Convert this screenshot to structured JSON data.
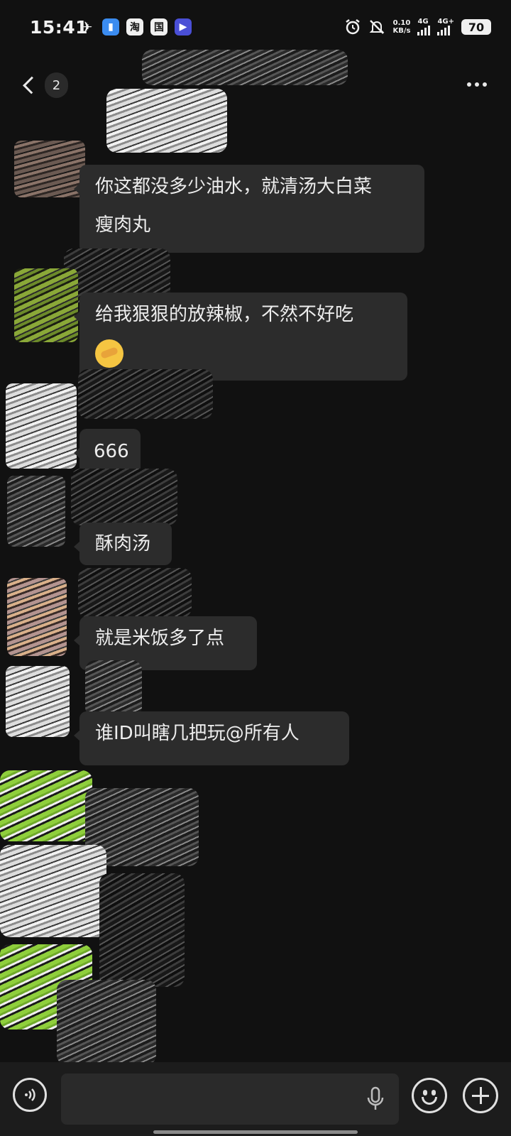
{
  "status_bar": {
    "time": "15:41",
    "app_icons": [
      {
        "name": "pinduoduo-icon",
        "glyph": "✈",
        "style": "plain"
      },
      {
        "name": "notes-app-icon",
        "glyph": "▮",
        "style": "blue"
      },
      {
        "name": "taobao-icon",
        "glyph": "淘",
        "style": ""
      },
      {
        "name": "bank-app-icon",
        "glyph": "国",
        "style": ""
      },
      {
        "name": "video-app-icon",
        "glyph": "▶",
        "style": "purple"
      }
    ],
    "net_speed_value": "0.10",
    "net_speed_unit": "KB/s",
    "signal1_label": "4G",
    "signal2_label": "4G+",
    "battery": "70"
  },
  "header": {
    "unread_count": "2"
  },
  "messages": [
    {
      "text_lines": [
        "你这都没多少油水，就清汤大白菜",
        "瘦肉丸"
      ]
    },
    {
      "text_lines": [
        "给我狠狠的放辣椒，不然不好吃"
      ],
      "emoji": "face-with-hand-over-mouth"
    },
    {
      "text_lines": [
        "666"
      ]
    },
    {
      "text_lines": [
        "酥肉汤"
      ]
    },
    {
      "text_lines": [
        "就是米饭多了点"
      ]
    },
    {
      "text_lines": [
        "谁ID叫瞎几把玩@所有人"
      ]
    }
  ],
  "input_bar": {
    "placeholder": ""
  },
  "colors": {
    "background": "#111111",
    "bubble": "#2c2c2c",
    "input_bar": "#1c1c1c",
    "text": "#ededed"
  }
}
